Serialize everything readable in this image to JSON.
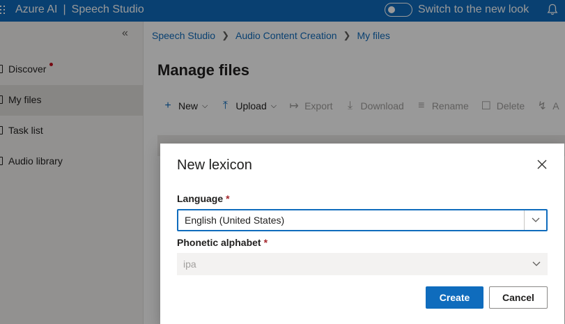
{
  "topbar": {
    "brand": "Azure AI",
    "separator": "|",
    "product": "Speech Studio",
    "switch_label": "Switch to the new look",
    "toggle_on": false
  },
  "sidebar": {
    "collapse_icon": "double-chevron-left-icon",
    "items": [
      {
        "label": "Discover",
        "badge": true
      },
      {
        "label": "My files",
        "active": true
      },
      {
        "label": "Task list"
      },
      {
        "label": "Audio library"
      }
    ]
  },
  "breadcrumb": [
    "Speech Studio",
    "Audio Content Creation",
    "My files"
  ],
  "page_title": "Manage files",
  "toolbar": {
    "new": "New",
    "upload": "Upload",
    "export": "Export",
    "download": "Download",
    "rename": "Rename",
    "delete": "Delete",
    "more_partial": "A"
  },
  "dialog": {
    "title": "New lexicon",
    "language_label": "Language",
    "language_required": "*",
    "language_value": "English (United States)",
    "phonetic_label": "Phonetic alphabet",
    "phonetic_required": "*",
    "phonetic_value": "ipa",
    "create_label": "Create",
    "cancel_label": "Cancel"
  },
  "colors": {
    "accent": "#0f6cbd",
    "required": "#a4262c",
    "badge": "#c50f1f"
  }
}
